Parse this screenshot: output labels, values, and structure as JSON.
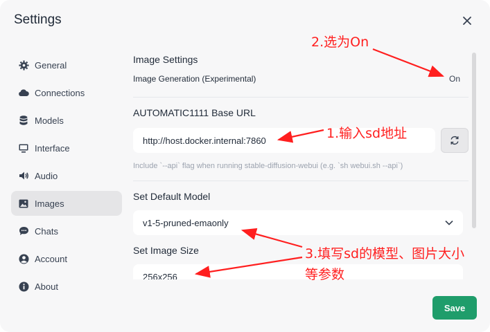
{
  "window": {
    "title": "Settings"
  },
  "sidebar": {
    "items": [
      {
        "label": "General",
        "icon": "gear-icon"
      },
      {
        "label": "Connections",
        "icon": "cloud-icon"
      },
      {
        "label": "Models",
        "icon": "database-icon"
      },
      {
        "label": "Interface",
        "icon": "monitor-icon"
      },
      {
        "label": "Audio",
        "icon": "speaker-icon"
      },
      {
        "label": "Images",
        "icon": "image-icon",
        "active": true
      },
      {
        "label": "Chats",
        "icon": "chat-icon"
      },
      {
        "label": "Account",
        "icon": "user-icon"
      },
      {
        "label": "About",
        "icon": "info-icon"
      }
    ]
  },
  "images": {
    "section_title": "Image Settings",
    "generation_label": "Image Generation (Experimental)",
    "generation_value": "On",
    "base_url_title": "AUTOMATIC1111 Base URL",
    "base_url_value": "http://host.docker.internal:7860",
    "base_url_hint": "Include `--api` flag when running stable-diffusion-webui (e.g. `sh webui.sh --api`)",
    "default_model_title": "Set Default Model",
    "default_model_value": "v1-5-pruned-emaonly",
    "image_size_title": "Set Image Size",
    "image_size_value": "256x256"
  },
  "footer": {
    "save_label": "Save"
  },
  "annotations": {
    "step1": "1.输入sd地址",
    "step2": "2.选为On",
    "step3_line1": "3.填写sd的模型、图片大小",
    "step3_line2": "等参数",
    "color": "#ff1f1f"
  },
  "colors": {
    "accent": "#1f9d6b",
    "active_bg": "#e5e5e7"
  }
}
